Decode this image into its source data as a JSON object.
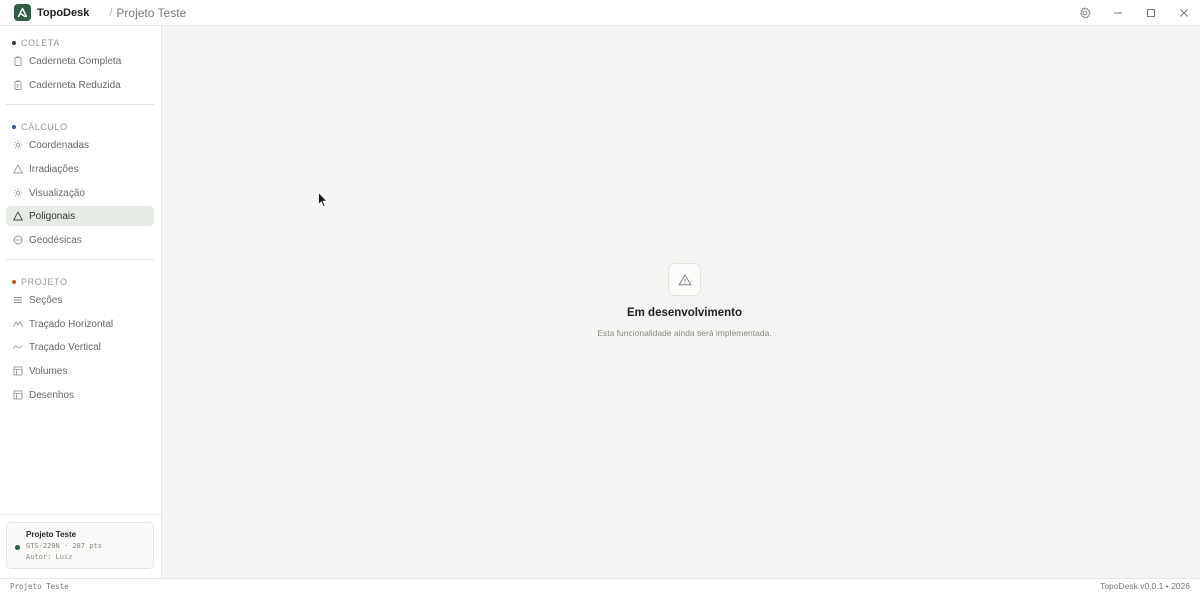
{
  "titlebar": {
    "app_name": "TopoDesk",
    "separator": "/",
    "project_name": "Projeto Teste",
    "controls": [
      "gear-icon",
      "minimize-icon",
      "maximize-icon",
      "close-icon"
    ]
  },
  "sidebar": {
    "sections": [
      {
        "label": "COLETA",
        "dot_color": "#3a3a3a",
        "items": [
          {
            "label": "Caderneta Completa",
            "icon": "clipboard-icon"
          },
          {
            "label": "Caderneta Reduzida",
            "icon": "clipboard-icon"
          }
        ]
      },
      {
        "label": "CÁLCULO",
        "dot_color": "#3b4bb5",
        "items": [
          {
            "label": "Coordenadas",
            "icon": "sun-icon"
          },
          {
            "label": "Irradiações",
            "icon": "triangle-icon"
          },
          {
            "label": "Visualização",
            "icon": "sun-icon"
          },
          {
            "label": "Poligonais",
            "icon": "triangle-icon",
            "active": true
          },
          {
            "label": "Geodésicas",
            "icon": "globe-icon"
          }
        ]
      },
      {
        "label": "PROJETO",
        "dot_color": "#c0502a",
        "items": [
          {
            "label": "Seções",
            "icon": "list-icon"
          },
          {
            "label": "Traçado Horizontal",
            "icon": "mountain-icon"
          },
          {
            "label": "Traçado Vertical",
            "icon": "wave-icon"
          },
          {
            "label": "Volumes",
            "icon": "table-icon"
          },
          {
            "label": "Desenhos",
            "icon": "table-icon"
          }
        ]
      }
    ]
  },
  "project_card": {
    "title": "Projeto Teste",
    "equipment": "GTS-229N · 287 pts",
    "author": "Autor: Luiz"
  },
  "main": {
    "empty_state": {
      "icon": "warning-icon",
      "title": "Em desenvolvimento",
      "description": "Esta funcionalidade ainda será implementada."
    }
  },
  "statusbar": {
    "left": "Projeto Teste",
    "right": "TopoDesk v0.0.1 • 2026"
  },
  "colors": {
    "accent": "#2f5d46",
    "active_bg": "#e7ebe6",
    "main_bg": "#f5f5f3"
  }
}
